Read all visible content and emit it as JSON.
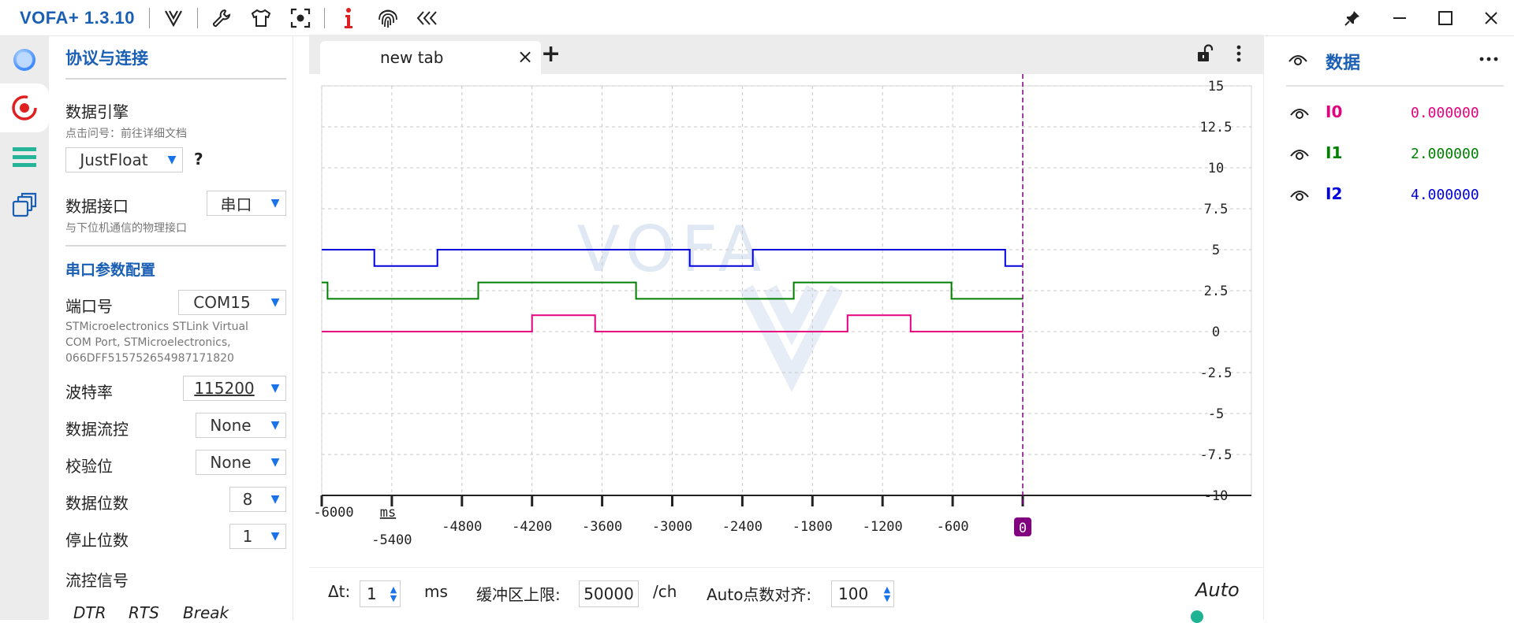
{
  "app": {
    "title": "VOFA+ 1.3.10"
  },
  "toolbar": {
    "icons": [
      "vofa-logo-icon",
      "wrench-icon",
      "tshirt-icon",
      "screenshot-icon",
      "info-icon",
      "fingerprint-icon",
      "collapse-left-icon"
    ]
  },
  "rail": {
    "items": [
      "connection-icon",
      "record-icon",
      "list-icon",
      "windows-icon"
    ]
  },
  "panel": {
    "section_title": "协议与连接",
    "engine_label": "数据引擎",
    "engine_hint": "点击问号：前往详细文档",
    "engine_value": "JustFloat",
    "help_mark": "?",
    "interface_label": "数据接口",
    "interface_value": "串口",
    "interface_hint": "与下位机通信的物理接口",
    "serial_title": "串口参数配置",
    "port_label": "端口号",
    "port_value": "COM15",
    "port_desc_1": "STMicroelectronics STLink Virtual",
    "port_desc_2": "COM Port, STMicroelectronics,",
    "port_desc_3": "066DFF515752654987171820",
    "baud_label": "波特率",
    "baud_value": "115200",
    "flow_label": "数据流控",
    "flow_value": "None",
    "parity_label": "校验位",
    "parity_value": "None",
    "databits_label": "数据位数",
    "databits_value": "8",
    "stopbits_label": "停止位数",
    "stopbits_value": "1",
    "flowsig_label": "流控信号",
    "dtr_label": "DTR",
    "rts_label": "RTS",
    "break_label": "Break"
  },
  "tabs": {
    "active_label": "new tab",
    "close": "×",
    "add": "+"
  },
  "chart_data": {
    "type": "line",
    "watermark": "VOFA",
    "x_unit": "ms",
    "x_ticks": [
      "-6000",
      "-5400",
      "-4800",
      "-4200",
      "-3600",
      "-3000",
      "-2400",
      "-1800",
      "-1200",
      "-600",
      "0"
    ],
    "y_ticks": [
      "15",
      "12.5",
      "10",
      "7.5",
      "5",
      "2.5",
      "0",
      "-2.5",
      "-5",
      "-7.5",
      "-10"
    ],
    "xlim": [
      -6000,
      0
    ],
    "ylim": [
      -10,
      15
    ],
    "grid": true,
    "series": [
      {
        "name": "I0",
        "color": "#e6007e",
        "x": [
          -6000,
          -4200,
          -4200,
          -3660,
          -3660,
          -1500,
          -1500,
          -960,
          -960,
          0
        ],
        "y": [
          0,
          0,
          1,
          1,
          0,
          0,
          1,
          1,
          0,
          0
        ]
      },
      {
        "name": "I1",
        "color": "#008000",
        "x": [
          -6000,
          -5950,
          -5950,
          -4660,
          -4660,
          -3310,
          -3310,
          -1960,
          -1960,
          -610,
          -610,
          0
        ],
        "y": [
          3,
          3,
          2,
          2,
          3,
          3,
          2,
          2,
          3,
          3,
          2,
          2
        ]
      },
      {
        "name": "I2",
        "color": "#0000dd",
        "x": [
          -6000,
          -5550,
          -5550,
          -5010,
          -5010,
          -2850,
          -2850,
          -2310,
          -2310,
          -150,
          -150,
          0
        ],
        "y": [
          5,
          5,
          4,
          4,
          5,
          5,
          4,
          4,
          5,
          5,
          4,
          4
        ]
      }
    ]
  },
  "bottom": {
    "dt_label": "Δt:",
    "dt_value": "1",
    "dt_unit": "ms",
    "buffer_label": "缓冲区上限:",
    "buffer_value": "50000",
    "buffer_unit": "/ch",
    "align_label": "Auto点数对齐:",
    "align_value": "100",
    "auto_label": "Auto"
  },
  "data_panel": {
    "title": "数据",
    "channels": [
      {
        "name": "I0",
        "value": "0.000000",
        "color": "#e6007e"
      },
      {
        "name": "I1",
        "value": "2.000000",
        "color": "#008000"
      },
      {
        "name": "I2",
        "value": "4.000000",
        "color": "#0000dd"
      }
    ]
  },
  "colors": {
    "accent": "#1a5fb4",
    "arrow": "#1a73e8",
    "marker": "#800080"
  }
}
